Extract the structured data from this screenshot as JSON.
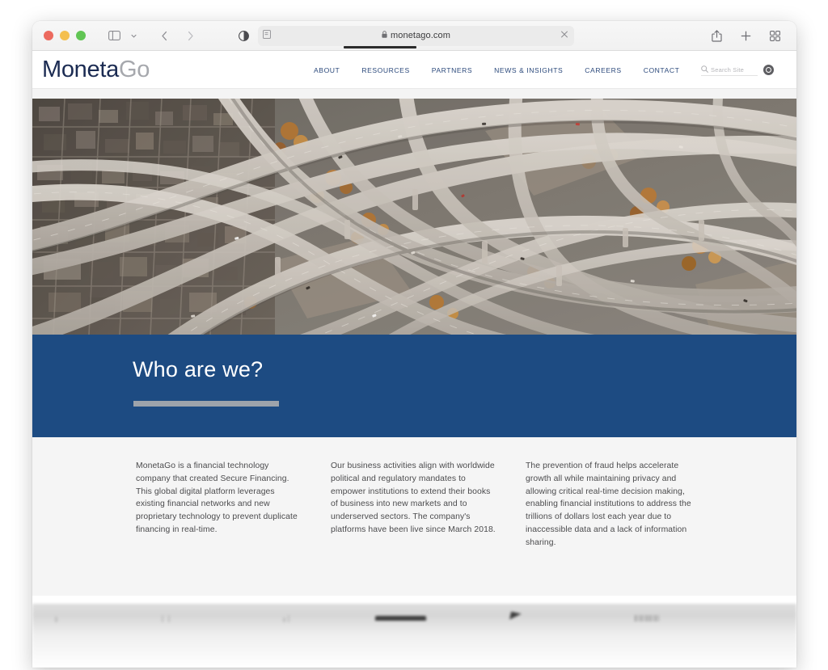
{
  "browser": {
    "traffic_lights": [
      "close",
      "minimize",
      "zoom"
    ],
    "sidebar_toggle_icon": "sidebar-icon",
    "sidebar_menu_icon": "chevron-down-icon",
    "back_icon": "chevron-left-icon",
    "forward_icon": "chevron-right-icon",
    "reader_icon": "reader-contrast-icon",
    "page_settings_icon": "page-settings-icon",
    "lock_icon": "lock-icon",
    "url": "monetago.com",
    "stop_icon": "close-icon",
    "share_icon": "share-icon",
    "new_tab_icon": "plus-icon",
    "tab_overview_icon": "tab-overview-icon"
  },
  "site": {
    "logo": {
      "primary": "Moneta",
      "secondary": "Go"
    },
    "nav": [
      {
        "label": "ABOUT"
      },
      {
        "label": "RESOURCES"
      },
      {
        "label": "PARTNERS"
      },
      {
        "label": "NEWS & INSIGHTS"
      },
      {
        "label": "CAREERS"
      },
      {
        "label": "CONTACT"
      }
    ],
    "search": {
      "icon": "search-icon",
      "placeholder": "Search Site",
      "value": "",
      "submit_icon": "search-submit-icon"
    }
  },
  "hero": {
    "alt": "Aerial view of a multi-level highway interchange"
  },
  "who_section": {
    "title": "Who are we?",
    "accent_color": "#1d4b82",
    "rule_color": "#9da3ab"
  },
  "columns": [
    {
      "text": "MonetaGo is a financial technology company that created Secure Financing. This global digital platform leverages existing financial networks and new proprietary technology to prevent duplicate financing in real-time."
    },
    {
      "text": "Our business activities align with worldwide political and regulatory mandates to empower institutions to extend their books of business into new markets and to underserved sectors. The company's platforms have been live since March 2018."
    },
    {
      "text": "The prevention of fraud helps accelerate growth all while maintaining privacy and allowing critical real-time decision making, enabling financial institutions to address the trillions of dollars lost each year due to inaccessible data and a lack of information sharing."
    }
  ]
}
